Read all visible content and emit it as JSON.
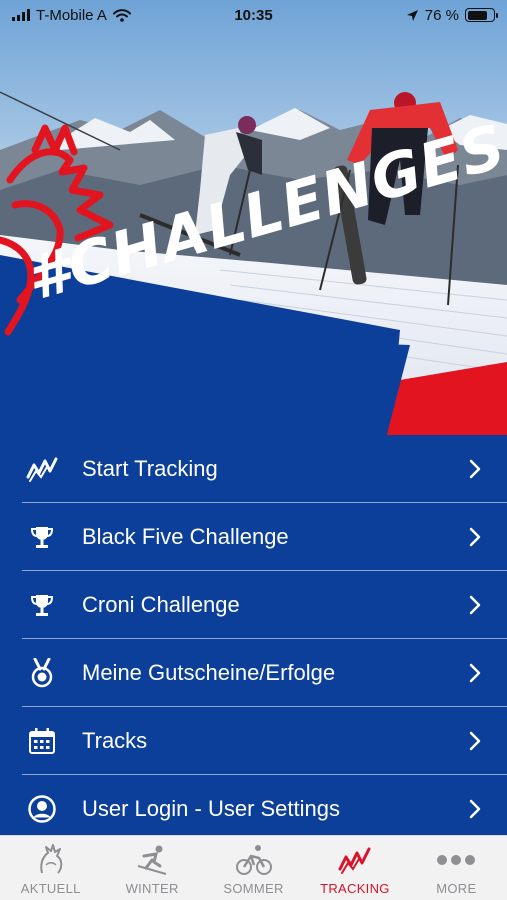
{
  "status_bar": {
    "carrier": "T-Mobile A",
    "time": "10:35",
    "battery_text": "76 %",
    "battery_level": 0.76
  },
  "hero": {
    "title": "#CHALLENGES"
  },
  "menu": {
    "items": [
      {
        "label": "Start Tracking",
        "icon": "tracking-icon"
      },
      {
        "label": "Black Five Challenge",
        "icon": "trophy-icon"
      },
      {
        "label": "Croni Challenge",
        "icon": "trophy-icon"
      },
      {
        "label": "Meine Gutscheine/Erfolge",
        "icon": "medal-icon"
      },
      {
        "label": "Tracks",
        "icon": "calendar-icon"
      },
      {
        "label": "User Login - User Settings",
        "icon": "user-icon"
      }
    ]
  },
  "tab_bar": {
    "active": "TRACKING",
    "tabs": [
      {
        "label": "AKTUELL",
        "icon": "rooster-icon"
      },
      {
        "label": "WINTER",
        "icon": "skier-icon"
      },
      {
        "label": "SOMMER",
        "icon": "cyclist-icon"
      },
      {
        "label": "TRACKING",
        "icon": "tracking-icon"
      },
      {
        "label": "MORE",
        "icon": "more-icon"
      }
    ]
  },
  "colors": {
    "brand_blue": "#0b3f99",
    "brand_red": "#e2141f",
    "tab_active": "#d7142a",
    "tab_inactive": "#8e8e93"
  }
}
